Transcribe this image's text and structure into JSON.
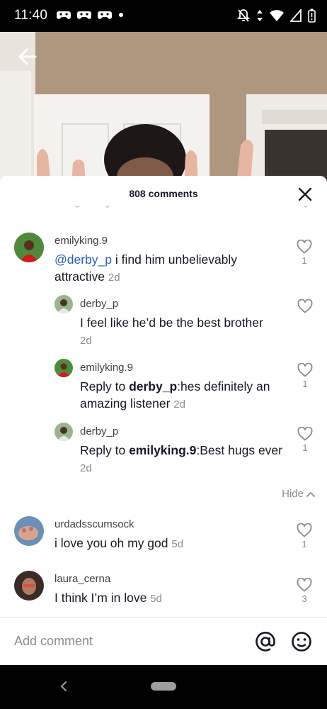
{
  "status_bar": {
    "time": "11:40"
  },
  "sheet": {
    "title": "808 comments"
  },
  "comments": [
    {
      "username": "emilyking.9",
      "mention": "@derby_p",
      "text": " i find him unbelievably attractive",
      "time": "2d",
      "likes": "1"
    },
    {
      "username": "derby_p",
      "text": "I feel like he’d be the best brother",
      "time": "2d",
      "likes": ""
    },
    {
      "username": "emilyking.9",
      "reply_prefix": "Reply to ",
      "reply_to": "derby_p",
      "text": ":hes definitely an amazing listener",
      "time": "2d",
      "likes": "1"
    },
    {
      "username": "derby_p",
      "reply_prefix": "Reply to ",
      "reply_to": "emilyking.9",
      "text": ":Best hugs ever",
      "time": "2d",
      "likes": "1"
    },
    {
      "username": "urdadsscumsock",
      "text": "i love you oh my god",
      "time": "5d",
      "likes": "1"
    },
    {
      "username": "laura_cerna",
      "text": "I think I’m in love",
      "time": "5d",
      "likes": "3"
    }
  ],
  "hide_label": "Hide",
  "input": {
    "placeholder": "Add comment"
  },
  "icons": {
    "back": "arrow-left-icon",
    "close": "close-icon",
    "like": "heart-outline-icon",
    "mention": "at-sign-icon",
    "emoji": "emoji-icon"
  },
  "colors": {
    "mention": "#2b5db9",
    "muted": "#8a8b91",
    "text": "#161823"
  }
}
